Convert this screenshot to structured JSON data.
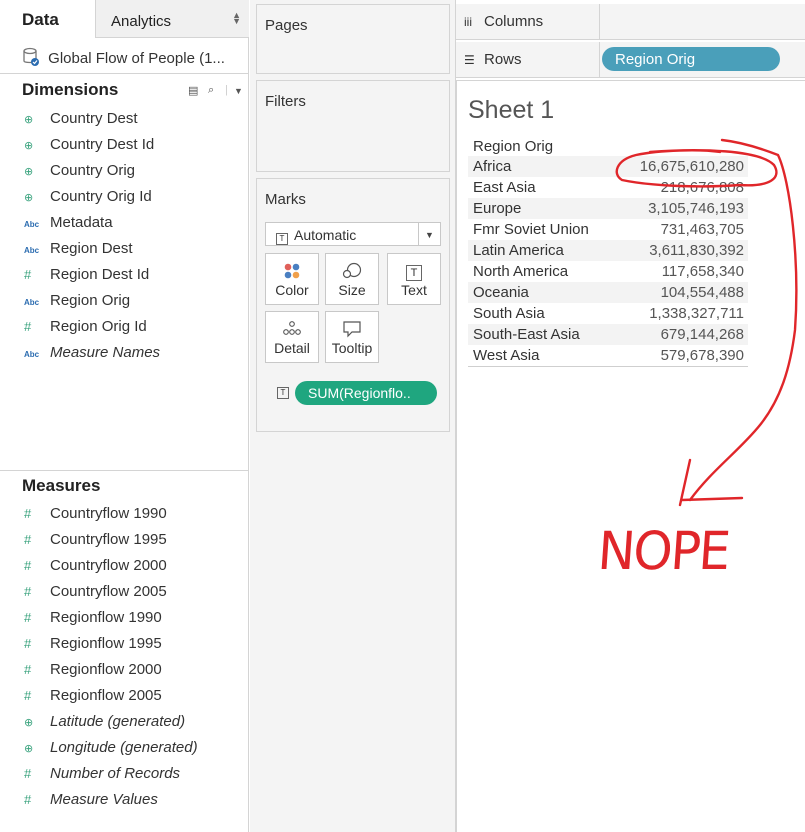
{
  "tabs": {
    "data": "Data",
    "analytics": "Analytics"
  },
  "datasource": {
    "name": "Global Flow of People (1..."
  },
  "dimensions": {
    "title": "Dimensions",
    "items": [
      {
        "label": "Country Dest",
        "icon": "globe-icon"
      },
      {
        "label": "Country Dest Id",
        "icon": "globe-icon"
      },
      {
        "label": "Country Orig",
        "icon": "globe-icon"
      },
      {
        "label": "Country Orig Id",
        "icon": "globe-icon"
      },
      {
        "label": "Metadata",
        "icon": "abc-icon"
      },
      {
        "label": "Region Dest",
        "icon": "abc-icon"
      },
      {
        "label": "Region Dest Id",
        "icon": "hash-icon"
      },
      {
        "label": "Region Orig",
        "icon": "abc-icon"
      },
      {
        "label": "Region Orig Id",
        "icon": "hash-icon"
      },
      {
        "label": "Measure Names",
        "icon": "abc-icon"
      }
    ]
  },
  "measures": {
    "title": "Measures",
    "items": [
      {
        "label": "Countryflow 1990",
        "icon": "hash-icon"
      },
      {
        "label": "Countryflow 1995",
        "icon": "hash-icon"
      },
      {
        "label": "Countryflow 2000",
        "icon": "hash-icon"
      },
      {
        "label": "Countryflow 2005",
        "icon": "hash-icon"
      },
      {
        "label": "Regionflow 1990",
        "icon": "hash-icon"
      },
      {
        "label": "Regionflow 1995",
        "icon": "hash-icon"
      },
      {
        "label": "Regionflow 2000",
        "icon": "hash-icon"
      },
      {
        "label": "Regionflow 2005",
        "icon": "hash-icon"
      },
      {
        "label": "Latitude (generated)",
        "icon": "globe-icon"
      },
      {
        "label": "Longitude (generated)",
        "icon": "globe-icon"
      },
      {
        "label": "Number of Records",
        "icon": "hash-icon"
      },
      {
        "label": "Measure Values",
        "icon": "hash-icon"
      }
    ]
  },
  "cards": {
    "pages": "Pages",
    "filters": "Filters",
    "marks": "Marks",
    "mark_type": "Automatic",
    "buttons": {
      "color": "Color",
      "size": "Size",
      "text": "Text",
      "detail": "Detail",
      "tooltip": "Tooltip"
    },
    "text_pill": "SUM(Regionflo..",
    "text_pill_icon": "T"
  },
  "shelves": {
    "columns": "Columns",
    "rows": "Rows",
    "rows_pill": "Region Orig"
  },
  "sheet": {
    "title": "Sheet 1",
    "header": "Region Orig",
    "rows": [
      {
        "region": "Africa",
        "value": "16,675,610,280"
      },
      {
        "region": "East Asia",
        "value": "218,676,808"
      },
      {
        "region": "Europe",
        "value": "3,105,746,193"
      },
      {
        "region": "Fmr Soviet Union",
        "value": "731,463,705"
      },
      {
        "region": "Latin America",
        "value": "3,611,830,392"
      },
      {
        "region": "North America",
        "value": "117,658,340"
      },
      {
        "region": "Oceania",
        "value": "104,554,488"
      },
      {
        "region": "South Asia",
        "value": "1,338,327,711"
      },
      {
        "region": "South-East Asia",
        "value": "679,144,268"
      },
      {
        "region": "West Asia",
        "value": "579,678,390"
      }
    ]
  },
  "annotation": {
    "text": "NOPE",
    "color": "#e0262a"
  },
  "colors": {
    "rows_pill": "#4a9fba",
    "text_pill": "#1fa67f",
    "panel": "#f4f4f4"
  }
}
